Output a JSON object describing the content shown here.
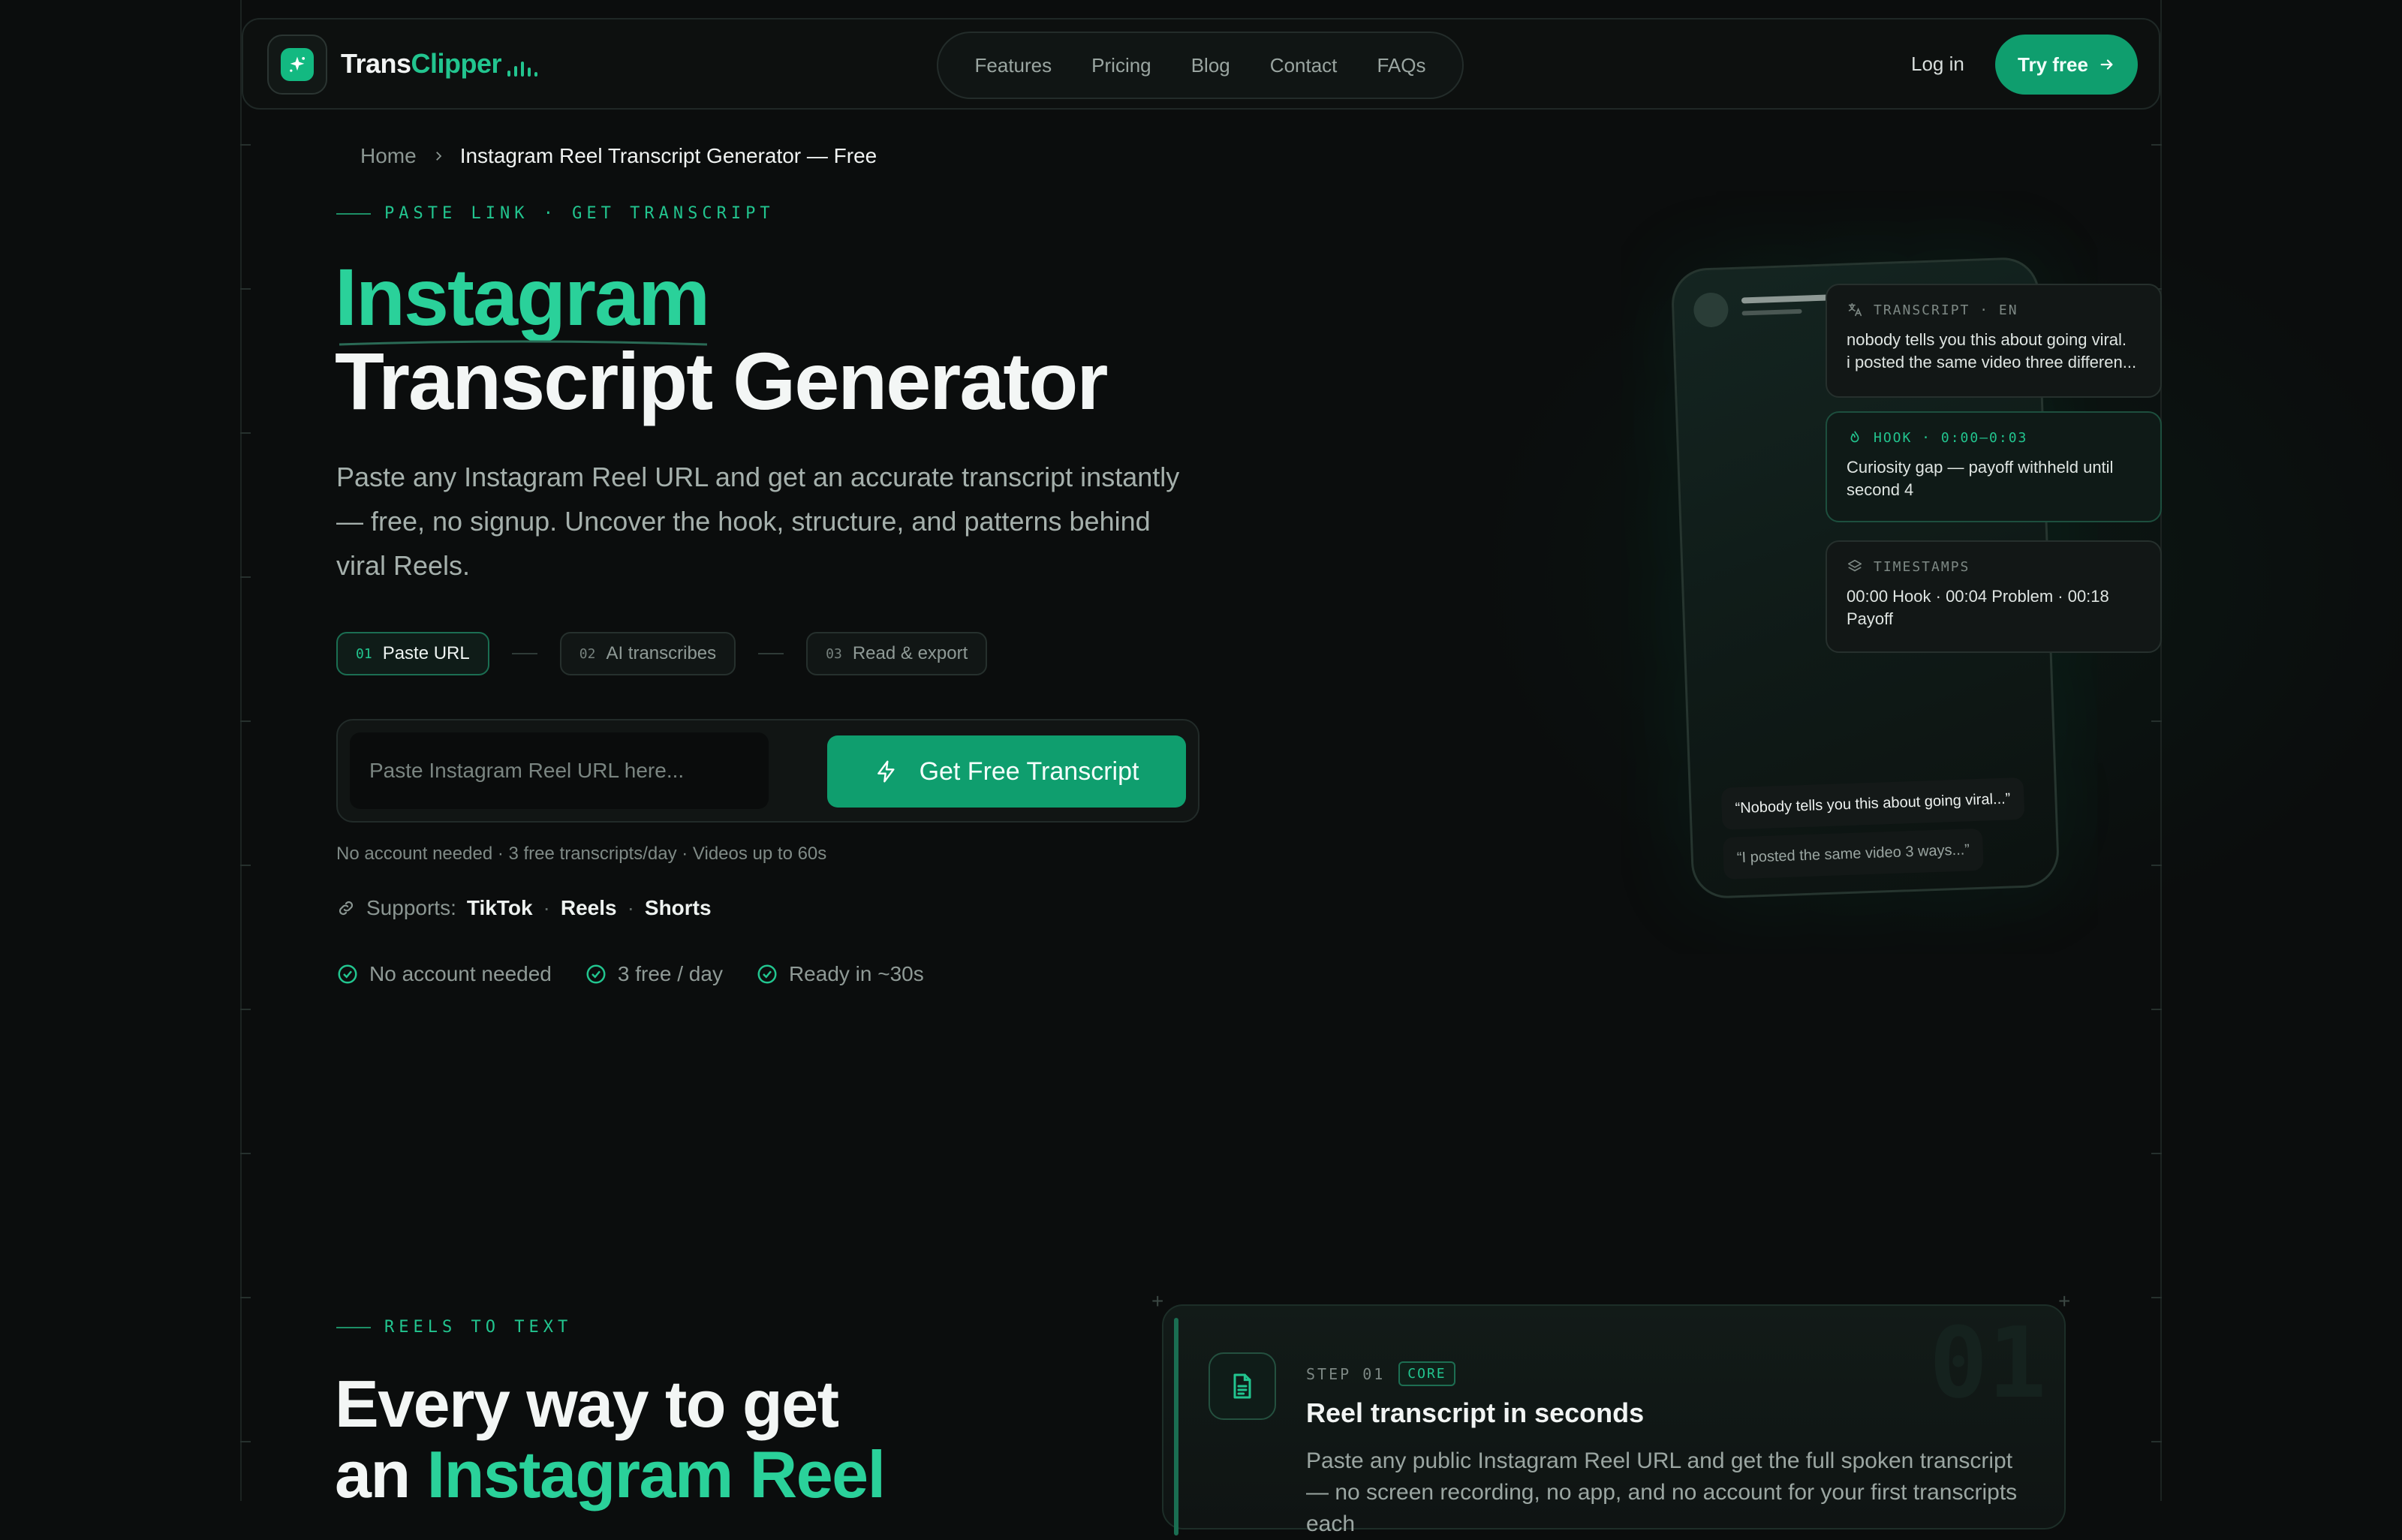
{
  "brand": {
    "name_part1": "Trans",
    "name_part2": "Clipper"
  },
  "nav": {
    "links": [
      "Features",
      "Pricing",
      "Blog",
      "Contact",
      "FAQs"
    ],
    "login": "Log in",
    "try_free": "Try free"
  },
  "breadcrumb": {
    "home": "Home",
    "current": "Instagram Reel Transcript Generator — Free"
  },
  "hero": {
    "eyebrow": "PASTE LINK · GET TRANSCRIPT",
    "title_line1": "Instagram",
    "title_line2": "Transcript Generator",
    "description": "Paste any Instagram Reel URL and get an accurate transcript instantly — free, no signup. Uncover the hook, structure, and patterns behind viral Reels.",
    "steps": [
      {
        "num": "01",
        "label": "Paste URL"
      },
      {
        "num": "02",
        "label": "AI transcribes"
      },
      {
        "num": "03",
        "label": "Read & export"
      }
    ],
    "input_placeholder": "Paste Instagram Reel URL here...",
    "cta": "Get Free Transcript",
    "note": "No account needed · 3 free transcripts/day · Videos up to 60s",
    "supports_label": "Supports:",
    "platforms": [
      "TikTok",
      "Reels",
      "Shorts"
    ],
    "checks": [
      "No account needed",
      "3 free / day",
      "Ready in ~30s"
    ]
  },
  "mock": {
    "transcript_card": {
      "header": "TRANSCRIPT · EN",
      "line1": "nobody tells you this about going viral.",
      "line2": "i posted the same video three differen..."
    },
    "hook_card": {
      "header": "HOOK · 0:00–0:03",
      "body": "Curiosity gap — payoff withheld until second 4"
    },
    "timestamps_card": {
      "header": "TIMESTAMPS",
      "body": "00:00 Hook · 00:04 Problem · 00:18 Payoff"
    },
    "bubble1": "“Nobody tells you this about going viral...”",
    "bubble2": "“I posted the same video 3 ways...”"
  },
  "section2": {
    "eyebrow": "REELS TO TEXT",
    "title_line1": "Every way to get",
    "title_line2_prefix": "an ",
    "title_line2_highlight": "Instagram Reel",
    "feature": {
      "step": "STEP 01",
      "badge": "CORE",
      "bignum": "01",
      "title": "Reel transcript in seconds",
      "desc": "Paste any public Instagram Reel URL and get the full spoken transcript — no screen recording, no app, and no account for your first transcripts each"
    }
  },
  "colors": {
    "accent": "#22c58f",
    "button": "#0f9e6e",
    "background": "#0b0d0d"
  }
}
